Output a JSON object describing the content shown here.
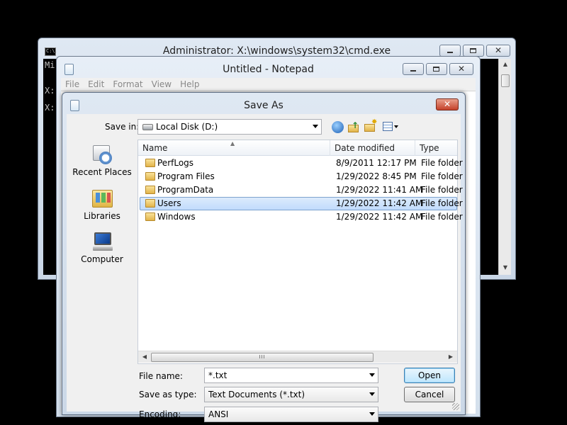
{
  "cmd": {
    "title": "Administrator: X:\\windows\\system32\\cmd.exe",
    "icon_text": "C:\\.",
    "lines": [
      "Mi",
      "X:",
      "X:"
    ]
  },
  "notepad": {
    "title": "Untitled - Notepad",
    "menu": [
      "File",
      "Edit",
      "Format",
      "View",
      "Help"
    ]
  },
  "saveas": {
    "title": "Save As",
    "save_in_label": "Save in:",
    "save_in_value": "Local Disk (D:)",
    "places": [
      {
        "label": "Recent Places",
        "icon": "recent-places-icon"
      },
      {
        "label": "Libraries",
        "icon": "libraries-icon"
      },
      {
        "label": "Computer",
        "icon": "computer-icon"
      }
    ],
    "columns": [
      "Name",
      "Date modified",
      "Type"
    ],
    "rows": [
      {
        "name": "PerfLogs",
        "date": "8/9/2011 12:17 PM",
        "type": "File folder"
      },
      {
        "name": "Program Files",
        "date": "1/29/2022 8:45 PM",
        "type": "File folder"
      },
      {
        "name": "ProgramData",
        "date": "1/29/2022 11:41 AM",
        "type": "File folder"
      },
      {
        "name": "Users",
        "date": "1/29/2022 11:42 AM",
        "type": "File folder",
        "selected": true
      },
      {
        "name": "Windows",
        "date": "1/29/2022 11:42 AM",
        "type": "File folder"
      }
    ],
    "file_name_label": "File name:",
    "file_name_value": "*.txt",
    "save_as_type_label": "Save as type:",
    "save_as_type_value": "Text Documents (*.txt)",
    "encoding_label": "Encoding:",
    "encoding_value": "ANSI",
    "open_label": "Open",
    "cancel_label": "Cancel",
    "scroll_grip": "III"
  },
  "colors": {
    "selection": "#c1dbfc",
    "close_red": "#c4412a"
  }
}
